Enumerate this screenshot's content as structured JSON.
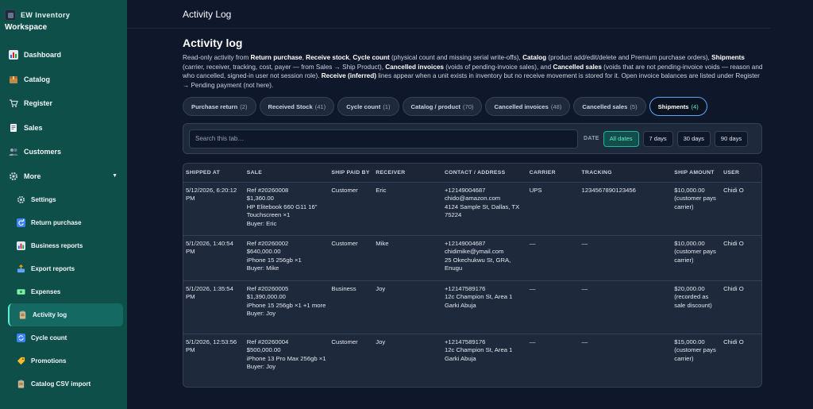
{
  "app": {
    "brand_name": "EW Inventory",
    "workspace": "Workspace"
  },
  "sidebar": {
    "items": [
      {
        "label": "Dashboard",
        "icon": "chart-icon"
      },
      {
        "label": "Catalog",
        "icon": "box-icon"
      },
      {
        "label": "Register",
        "icon": "cart-icon"
      },
      {
        "label": "Sales",
        "icon": "receipt-icon"
      },
      {
        "label": "Customers",
        "icon": "users-icon"
      },
      {
        "label": "More",
        "icon": "gear-icon"
      }
    ],
    "more_items": [
      {
        "label": "Settings"
      },
      {
        "label": "Return purchase"
      },
      {
        "label": "Business reports"
      },
      {
        "label": "Export reports"
      },
      {
        "label": "Expenses"
      },
      {
        "label": "Activity log"
      },
      {
        "label": "Cycle count"
      },
      {
        "label": "Promotions"
      },
      {
        "label": "Catalog CSV import"
      }
    ]
  },
  "header": {
    "title": "Activity Log"
  },
  "main": {
    "page_title": "Activity log",
    "desc": {
      "p1": "Read-only activity from ",
      "b1": "Return purchase",
      "p2": ", ",
      "b2": "Receive stock",
      "p3": ", ",
      "b3": "Cycle count",
      "p4": " (physical count and missing serial write-offs), ",
      "b4": "Catalog",
      "p5": " (product add/edit/delete and Premium purchase orders), ",
      "b5": "Shipments",
      "p6": " (carrier, receiver, tracking, cost, payer — from Sales → Ship Product), ",
      "b6": "Cancelled invoices",
      "p7": " (voids of pending-invoice sales), and ",
      "b7": "Cancelled sales",
      "p8": " (voids that are not pending-invoice voids — reason and who cancelled, signed-in user not session role). ",
      "b8": "Receive (inferred)",
      "p9": " lines appear when a unit exists in inventory but no receive movement is stored for it. Open invoice balances are listed under Register → Pending payment (not here)."
    },
    "tabs": [
      {
        "label": "Purchase return",
        "count": "(2)"
      },
      {
        "label": "Received Stock",
        "count": "(41)"
      },
      {
        "label": "Cycle count",
        "count": "(1)"
      },
      {
        "label": "Catalog / product",
        "count": "(70)"
      },
      {
        "label": "Cancelled invoices",
        "count": "(48)"
      },
      {
        "label": "Cancelled sales",
        "count": "(5)"
      },
      {
        "label": "Shipments",
        "count": "(4)"
      }
    ],
    "active_tab": "Shipments",
    "search": {
      "placeholder": "Search this tab…",
      "value": ""
    },
    "date_label": "DATE",
    "date_filters": [
      "All dates",
      "7 days",
      "30 days",
      "90 days"
    ],
    "active_date_filter": "All dates",
    "table": {
      "headers": [
        "SHIPPED AT",
        "SALE",
        "SHIP PAID BY",
        "RECEIVER",
        "CONTACT / ADDRESS",
        "CARRIER",
        "TRACKING",
        "SHIP AMOUNT",
        "USER"
      ],
      "rows": [
        {
          "shipped_at": "5/12/2026, 6:20:12 PM",
          "sale": [
            "Ref #20260008",
            "$1,360.00",
            "HP Elitebook 660 G11 16\" Touchscreen ×1",
            "Buyer: Eric"
          ],
          "paid_by": "Customer",
          "receiver": "Eric",
          "contact": [
            "+12149004687",
            "chido@amazon.com",
            "4124 Sample St, Dallas, TX 75224"
          ],
          "carrier": "UPS",
          "tracking": "1234567890123456",
          "amount": [
            "$10,000.00",
            "(customer pays carrier)"
          ],
          "user": "Chidi O"
        },
        {
          "shipped_at": "5/1/2026, 1:40:54 PM",
          "sale": [
            "Ref #20260002",
            "$640,000.00",
            "iPhone 15 256gb ×1",
            "Buyer: Mike"
          ],
          "paid_by": "Customer",
          "receiver": "Mike",
          "contact": [
            "+12149004687",
            "chidimike@ymail.com",
            "25 Okechukwu St, GRA, Enugu"
          ],
          "carrier": "—",
          "tracking": "—",
          "amount": [
            "$10,000.00",
            "(customer pays carrier)"
          ],
          "user": "Chidi O"
        },
        {
          "shipped_at": "5/1/2026, 1:35:54 PM",
          "sale": [
            "Ref #20260005",
            "$1,390,000.00",
            "iPhone 15 256gb ×1 +1 more",
            "Buyer: Joy"
          ],
          "paid_by": "Business",
          "receiver": "Joy",
          "contact": [
            "+12147589176",
            "12c Champion St, Area 1 Garki Abuja"
          ],
          "carrier": "—",
          "tracking": "—",
          "amount": [
            "$20,000.00",
            "(recorded as sale discount)"
          ],
          "user": "Chidi O"
        },
        {
          "shipped_at": "5/1/2026, 12:53:56 PM",
          "sale": [
            "Ref #20260004",
            "$500,000.00",
            "iPhone 13 Pro Max 256gb ×1",
            "Buyer: Joy"
          ],
          "paid_by": "Customer",
          "receiver": "Joy",
          "contact": [
            "+12147589176",
            "12c Champion St, Area 1 Garki Abuja"
          ],
          "carrier": "—",
          "tracking": "—",
          "amount": [
            "$15,000.00",
            "(customer pays carrier)"
          ],
          "user": "Chidi O"
        }
      ]
    }
  },
  "colors": {
    "sidebar_bg": "#0f4f4a",
    "main_bg": "#0f172a",
    "panel_bg": "#1e293b",
    "accent_teal": "#5eead4",
    "active_tab_border": "#60a5fa"
  }
}
